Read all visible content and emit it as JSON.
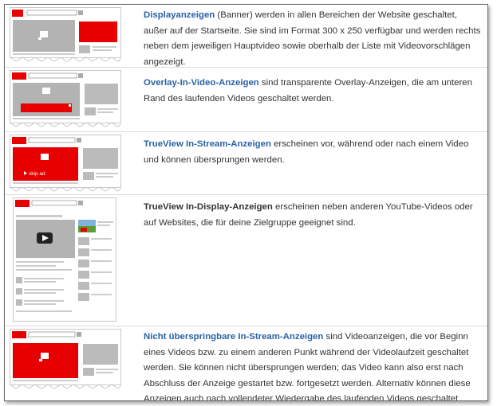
{
  "colors": {
    "link": "#2a62a6",
    "text": "#333333",
    "ad_red": "#e60000",
    "grey": "#b5b5b5"
  },
  "logo": {
    "you": "You",
    "tube": "Tube"
  },
  "ad_formats": [
    {
      "title": "Displayanzeigen",
      "title_style": "link",
      "description": " (Banner) werden in allen Bereichen der Website geschaltet, außer auf der Startseite. Sie sind im Format 300 x 250 verfügbar und werden rechts neben dem jeweiligen Hauptvideo sowie oberhalb der Liste mit Videovorschlägen angezeigt."
    },
    {
      "title": "Overlay-In-Video-Anzeigen",
      "title_style": "link",
      "description": " sind transparente Overlay-Anzeigen, die am unteren Rand des laufenden Videos geschaltet werden."
    },
    {
      "title": "TrueView In-Stream-Anzeigen",
      "title_style": "link",
      "description": " erscheinen vor, während oder nach einem Video und können übersprungen werden.",
      "skip_label": "skip ad"
    },
    {
      "title": "TrueView In-Display-Anzeigen",
      "title_style": "plain",
      "description": " erscheinen neben anderen YouTube-Videos oder auf Websites, die für deine Zielgruppe geeignet sind."
    },
    {
      "title": "Nicht überspringbare In-Stream-Anzeigen",
      "title_style": "link",
      "description": " sind Videoanzeigen, die vor Beginn eines Videos bzw. zu einem anderen Punkt während der Videolaufzeit geschaltet werden. Sie können nicht übersprungen werden; das Video kann also erst nach Abschluss der Anzeige gestartet bzw. fortgesetzt werden. Alternativ können diese Anzeigen auch nach vollendeter Wiedergabe des laufenden Videos geschaltet werden."
    }
  ]
}
